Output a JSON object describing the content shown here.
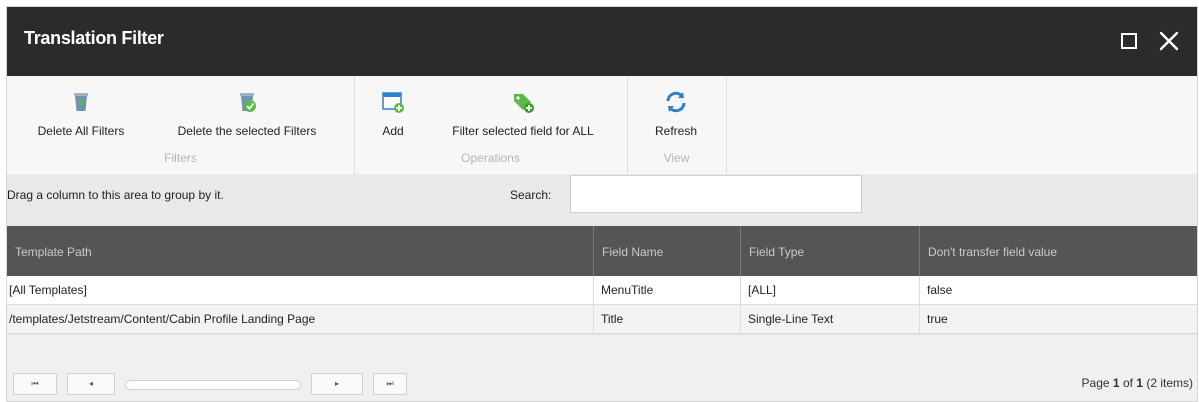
{
  "window": {
    "title": "Translation Filter"
  },
  "ribbon": {
    "groups": [
      {
        "label": "Filters",
        "buttons": [
          {
            "label": "Delete All Filters"
          },
          {
            "label": "Delete the selected Filters"
          }
        ]
      },
      {
        "label": "Operations",
        "buttons": [
          {
            "label": "Add"
          },
          {
            "label": "Filter selected field for ALL"
          }
        ]
      },
      {
        "label": "View",
        "buttons": [
          {
            "label": "Refresh"
          }
        ]
      }
    ]
  },
  "groupbar": {
    "text": "Drag a column to this area to group by it.",
    "search_label": "Search:",
    "search_value": ""
  },
  "grid": {
    "columns": [
      "Template Path",
      "Field Name",
      "Field Type",
      "Don't transfer field value"
    ],
    "rows": [
      [
        "[All Templates]",
        "MenuTitle",
        "[ALL]",
        "false"
      ],
      [
        "/templates/Jetstream/Content/Cabin Profile Landing Page",
        "Title",
        "Single-Line Text",
        "true"
      ]
    ]
  },
  "pager": {
    "page_prefix": "Page",
    "page_current": "1",
    "page_of": "of",
    "page_total": "1",
    "items_text": "(2 items)",
    "first_glyph": "⏮",
    "prev_glyph": "◂",
    "next_glyph": "▸",
    "last_glyph": "⏭"
  },
  "colors": {
    "titlebar": "#2b2b2b",
    "header": "#555555",
    "accent": "#2f80c8",
    "icon_green": "#5db84a"
  }
}
